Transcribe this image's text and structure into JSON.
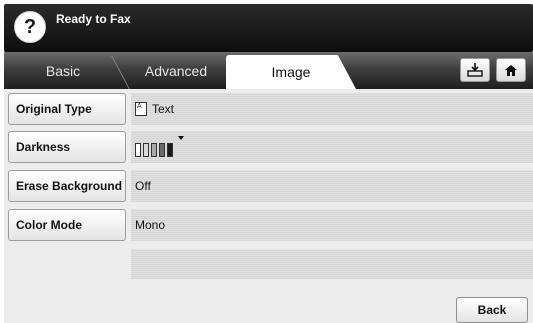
{
  "header": {
    "help_icon": "question-mark",
    "title": "Ready to Fax"
  },
  "tabs": [
    {
      "label": "Basic",
      "active": false
    },
    {
      "label": "Advanced",
      "active": false
    },
    {
      "label": "Image",
      "active": true
    }
  ],
  "toolbar": {
    "tray_icon": "tray-download-icon",
    "home_icon": "home-icon"
  },
  "rows": [
    {
      "label": "Original Type",
      "value": "Text",
      "icon": "document-icon"
    },
    {
      "label": "Darkness",
      "value": "",
      "levels": 5,
      "level": 5
    },
    {
      "label": "Erase Background",
      "value": "Off"
    },
    {
      "label": "Color Mode",
      "value": "Mono"
    }
  ],
  "footer": {
    "back_label": "Back"
  },
  "colors": {
    "header_bg": "#111111",
    "tab_active_bg": "#ffffff",
    "content_bg": "#ececec"
  }
}
